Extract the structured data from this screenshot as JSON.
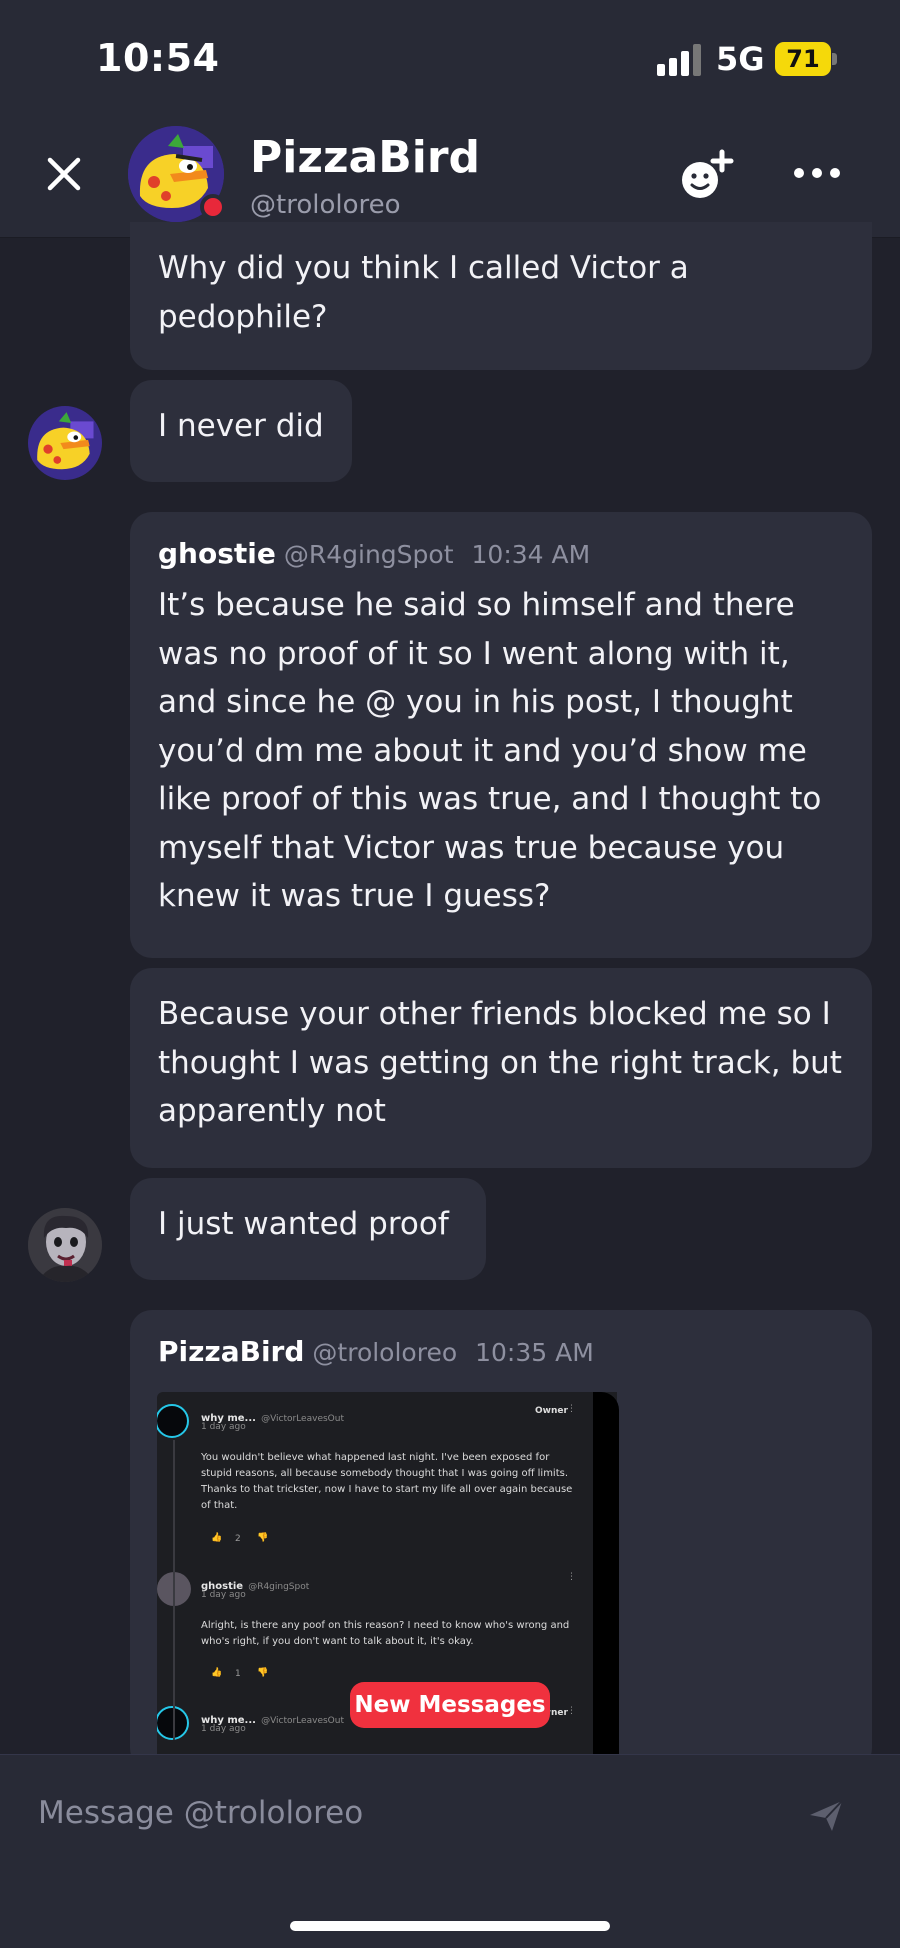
{
  "status_bar": {
    "time": "10:54",
    "network": "5G",
    "battery": "71"
  },
  "header": {
    "name": "PizzaBird",
    "handle": "@trololoreo"
  },
  "messages": [
    {
      "text": "Why did you think I called Victor a pedophile?"
    },
    {
      "text": "I never did"
    },
    {
      "author": "ghostie",
      "handle": "@R4gingSpot",
      "time": "10:34 AM",
      "text": "It’s because he said so himself and there was no proof of it so I went along with it, and since he @ you in his post, I thought you’d dm me about it and you’d show me like proof of this was true, and I thought to myself that Victor was true because you knew it was true I guess?"
    },
    {
      "text": "Because your other friends blocked me so I thought I was getting on the right track, but apparently not"
    },
    {
      "text": "I just wanted proof"
    },
    {
      "author": "PizzaBird",
      "handle": "@trololoreo",
      "time": "10:35 AM"
    }
  ],
  "shared_screenshot": {
    "post1": {
      "name": "why me...",
      "handle": "@VictorLeavesOut",
      "time": "1 day ago",
      "badge": "Owner",
      "text": "You wouldn't believe what happened last night. I've been exposed for stupid reasons, all because somebody thought that I was going off limits. Thanks to that trickster, now I have to start my life all over again because of that.",
      "likes": "2"
    },
    "post2": {
      "name": "ghostie",
      "handle": "@R4gingSpot",
      "time": "1 day ago",
      "text": "Alright, is there any poof on this reason? I need to know who's wrong and who's right, if you don't want to talk about it, it's okay.",
      "likes": "1"
    },
    "post3": {
      "name": "why me...",
      "handle": "@VictorLeavesOut",
      "time": "1 day ago",
      "badge": "Owner"
    }
  },
  "new_messages_label": "New Messages",
  "composer": {
    "placeholder": "Message @trololoreo"
  }
}
